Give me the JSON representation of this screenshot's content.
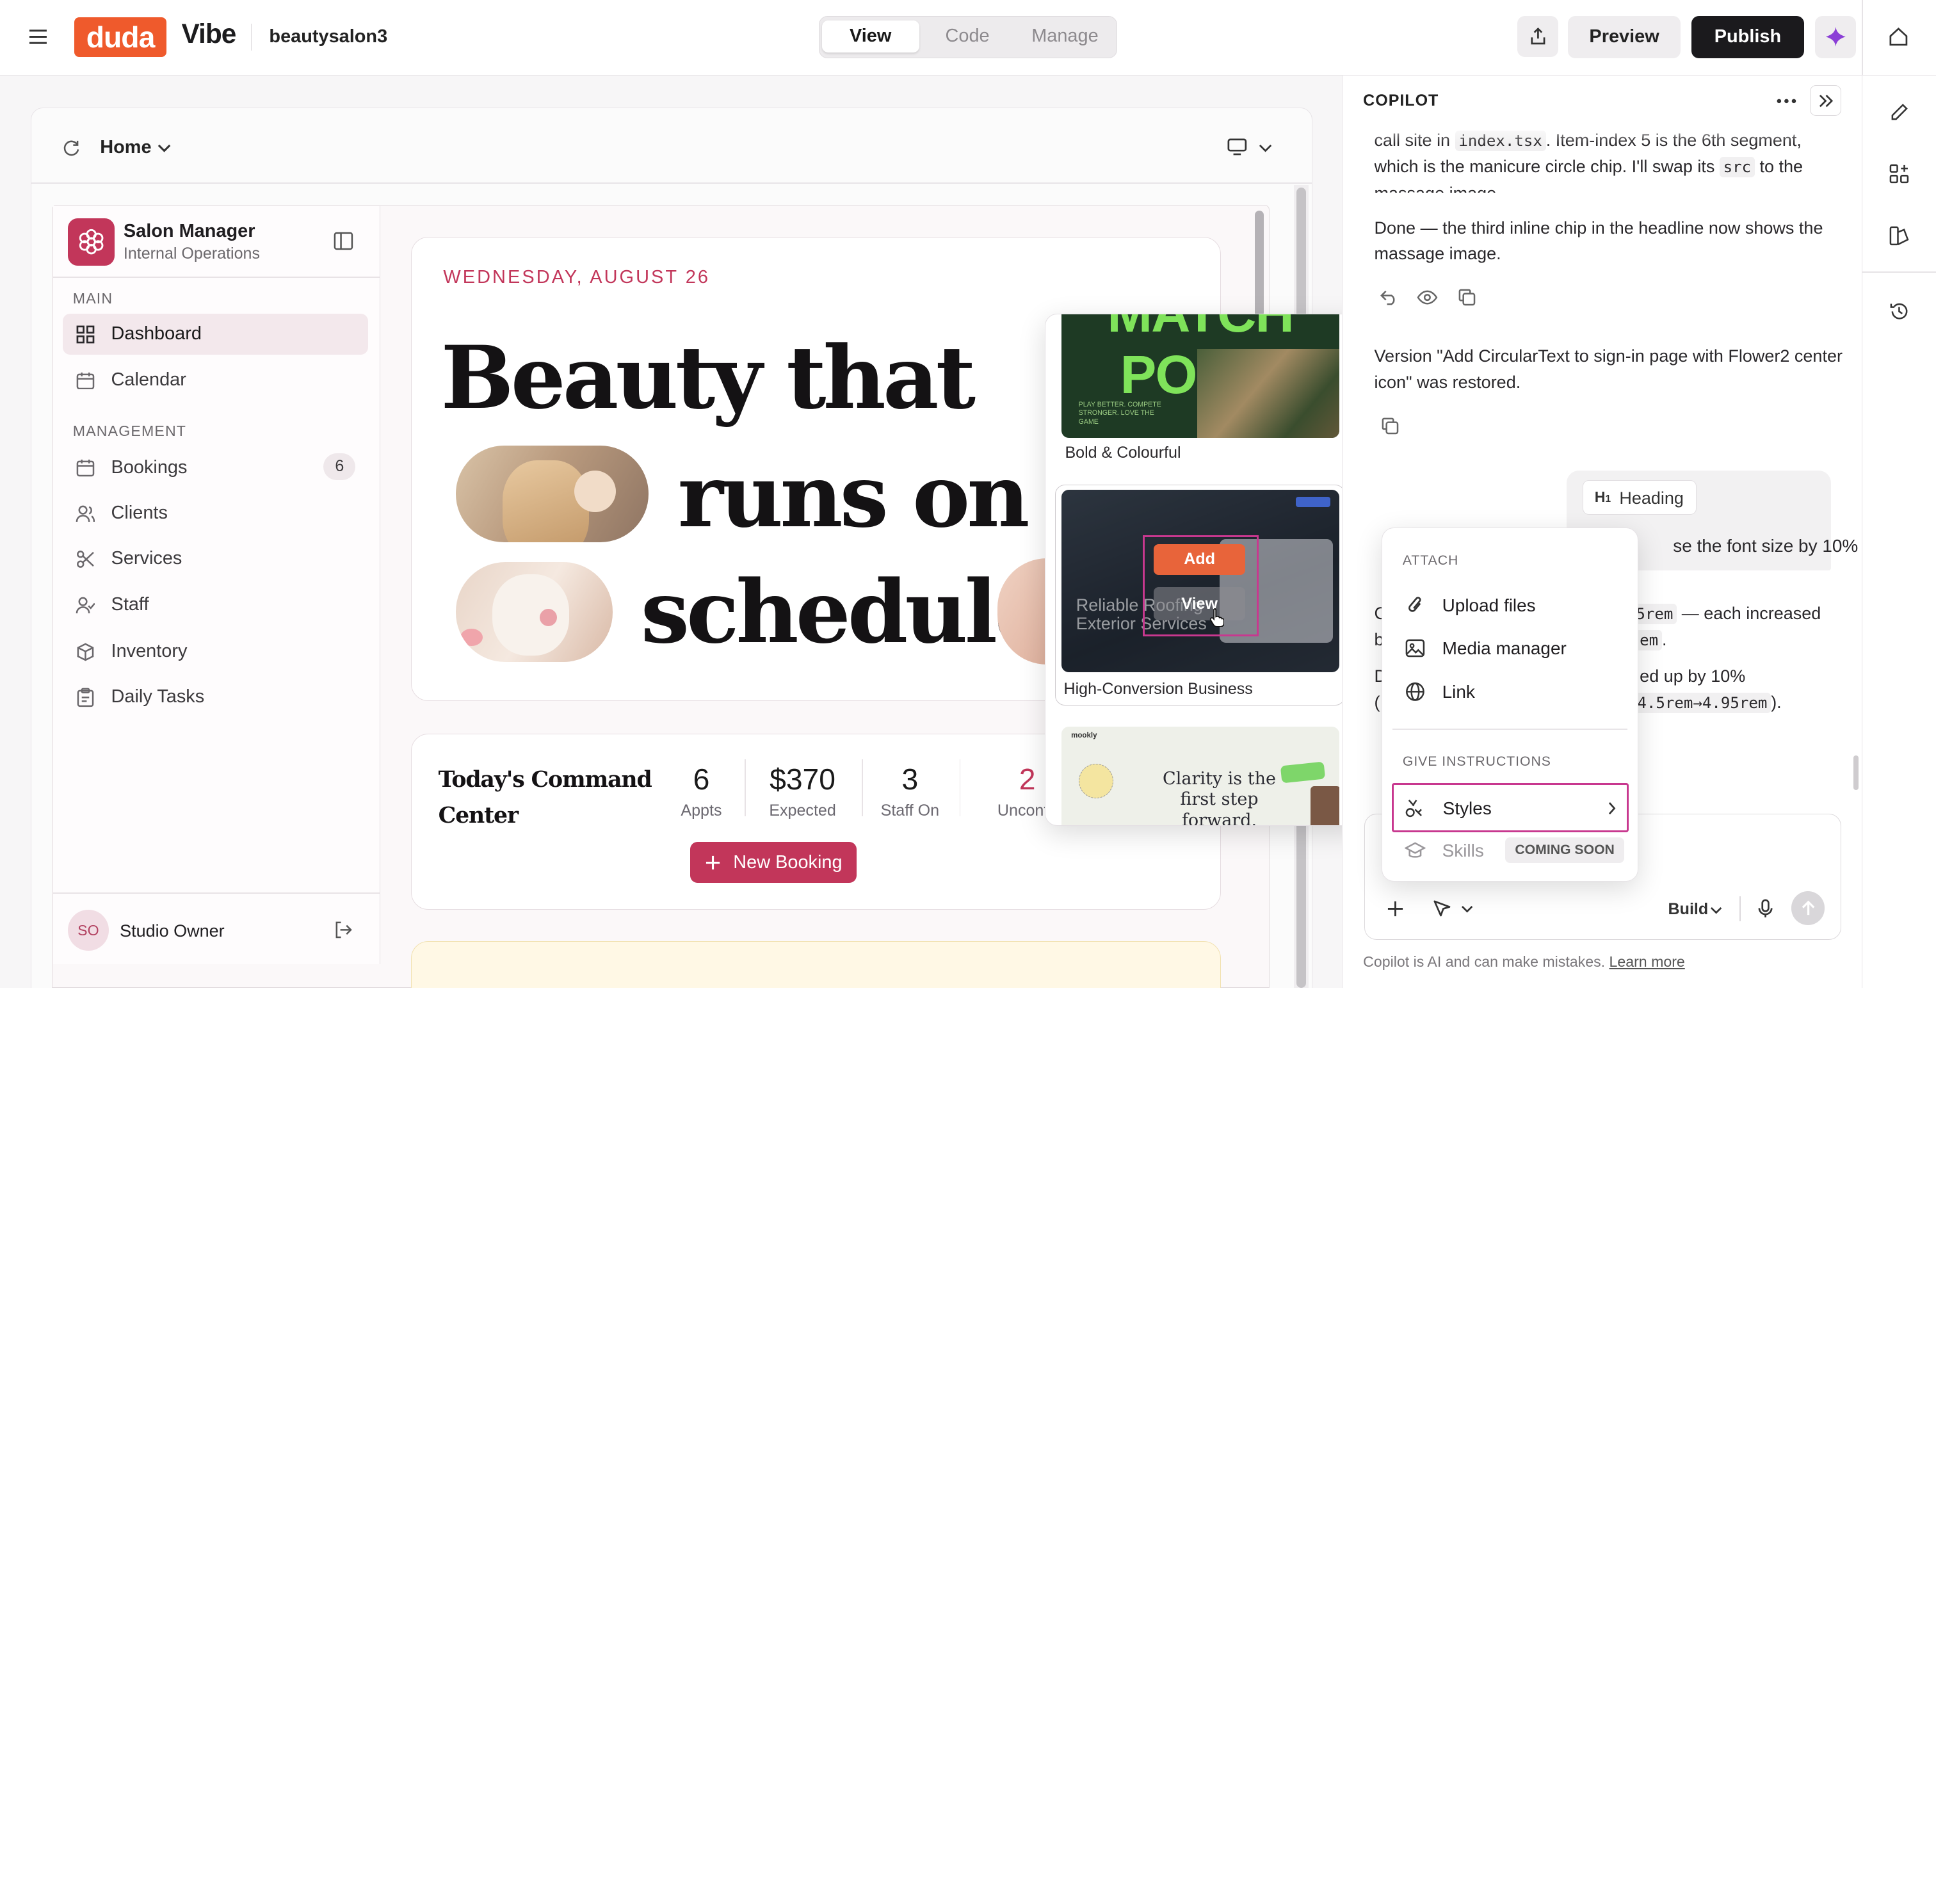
{
  "topbar": {
    "logo_text": "duda",
    "product": "Vibe",
    "site_name": "beautysalon3",
    "tabs": [
      "View",
      "Code",
      "Manage"
    ],
    "active_tab": "View",
    "preview_label": "Preview",
    "publish_label": "Publish"
  },
  "canvas_toolbar": {
    "page": "Home"
  },
  "app": {
    "brand_title": "Salon Manager",
    "brand_subtitle": "Internal Operations",
    "section_main": "MAIN",
    "section_management": "MANAGEMENT",
    "nav": {
      "dashboard": "Dashboard",
      "calendar": "Calendar",
      "bookings": "Bookings",
      "bookings_badge": "6",
      "clients": "Clients",
      "services": "Services",
      "staff": "Staff",
      "inventory": "Inventory",
      "daily_tasks": "Daily Tasks"
    },
    "user_initials": "SO",
    "user_name": "Studio Owner",
    "date": "WEDNESDAY, AUGUST 26",
    "headline": {
      "line1": "Beauty that",
      "line2": "runs on",
      "line3": "schedule"
    },
    "command_title_1": "Today's Command",
    "command_title_2": "Center",
    "stats": [
      {
        "value": "6",
        "label": "Appts"
      },
      {
        "value": "$370",
        "label": "Expected"
      },
      {
        "value": "3",
        "label": "Staff On"
      },
      {
        "value": "2",
        "label": "Unconfir"
      }
    ],
    "new_booking": "New Booking",
    "accent_color": "#c2365a"
  },
  "templates": {
    "items": [
      {
        "name": "Bold & Colourful",
        "thumb_title": "MATCH POINT",
        "thumb_tagline": "PLAY BETTER. COMPETE STRONGER. LOVE THE GAME"
      },
      {
        "name": "High-Conversion Business",
        "thumb_title": "Reliable Roofing Exterior Services",
        "overlay_add": "Add",
        "overlay_view": "View"
      },
      {
        "name": "",
        "thumb_title": "Clarity is the first step forward.",
        "thumb_brand": "mookly"
      }
    ]
  },
  "copilot": {
    "title": "COPILOT",
    "msg1": {
      "parts": [
        "call site in ",
        "index.tsx",
        ". Item-index 5 is the 6th segment, which is the manicure circle chip. I'll swap its ",
        "src",
        " to the massage image."
      ]
    },
    "msg2": "Done — the third inline chip in the headline now shows the massage image.",
    "msg3": "Version \"Add CircularText to sign-in page with Flower2 center icon\" was restored.",
    "user_chip": "Heading",
    "user_text": "se the font size by 10%",
    "partial_1a": "C",
    "partial_1b": "5rem",
    "partial_1c": " — each increased",
    "partial_2a": "b",
    "partial_2b": "em",
    "partial_2c": ".",
    "partial_3a": "D",
    "partial_3b": "ed up by 10%",
    "partial_4a": "(",
    "partial_4b": "4.5rem→4.95rem",
    "partial_4c": ").",
    "build_label": "Build",
    "disclaimer": "Copilot is AI and can make mistakes.",
    "learn_more": "Learn more"
  },
  "attach_menu": {
    "section_attach": "ATTACH",
    "upload": "Upload files",
    "media": "Media manager",
    "link": "Link",
    "section_instructions": "GIVE INSTRUCTIONS",
    "styles": "Styles",
    "skills": "Skills",
    "coming_soon": "COMING SOON"
  }
}
